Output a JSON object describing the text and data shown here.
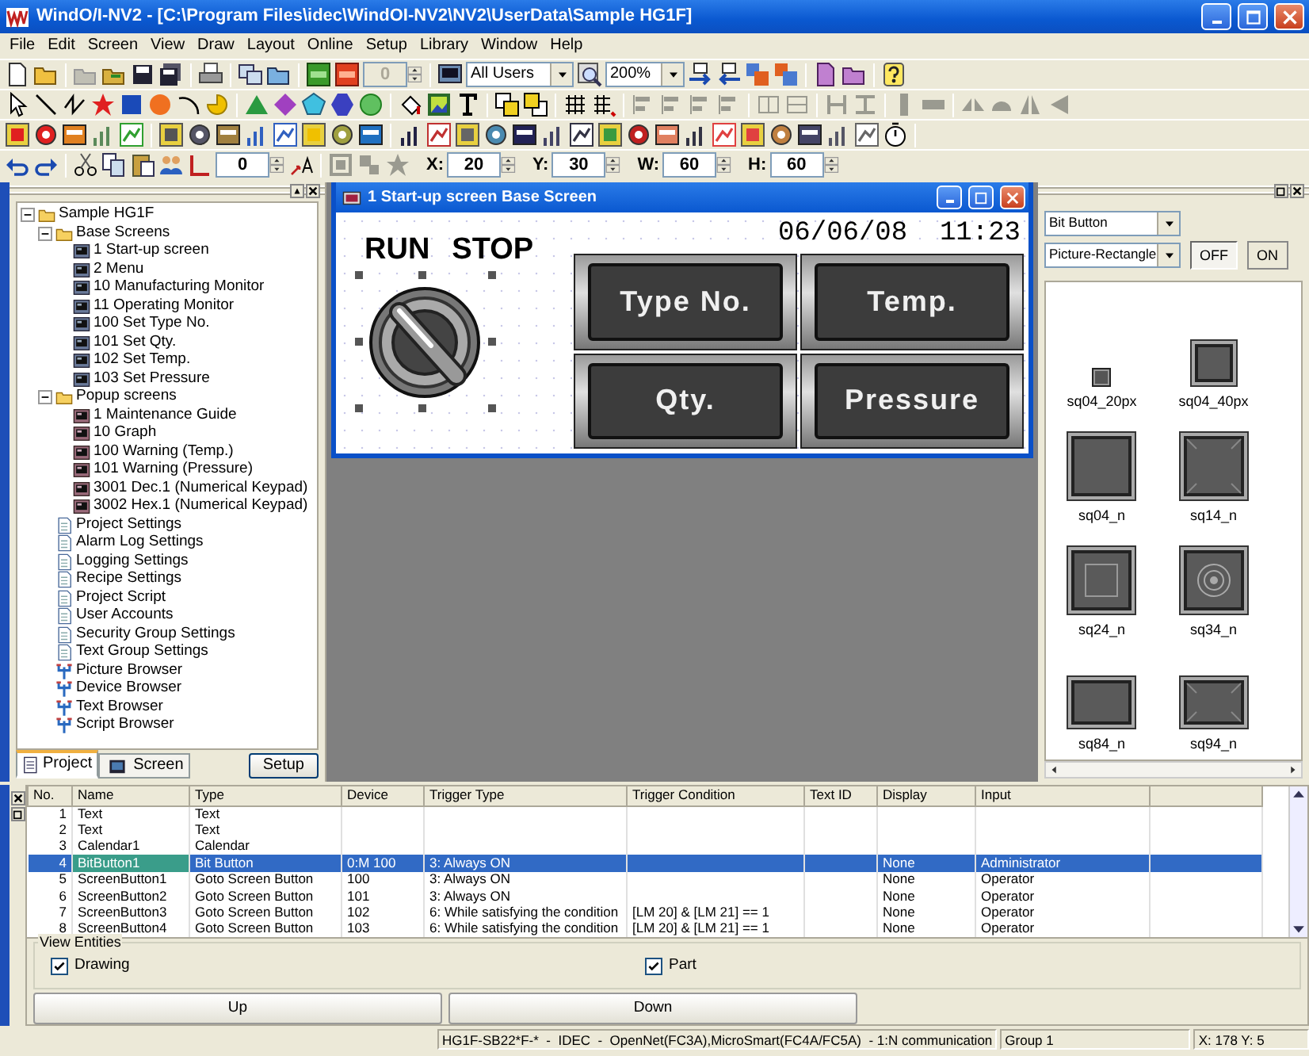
{
  "window": {
    "title": "WindO/I-NV2 - [C:\\Program Files\\idec\\WindOI-NV2\\NV2\\UserData\\Sample HG1F]"
  },
  "menu": [
    "File",
    "Edit",
    "Screen",
    "View",
    "Draw",
    "Layout",
    "Online",
    "Setup",
    "Library",
    "Window",
    "Help"
  ],
  "toolbar": {
    "spin_value": "0",
    "user_group": "All Users",
    "zoom": "200%"
  },
  "position_bar": {
    "rotate_value": "0",
    "fields": [
      {
        "label": "X:",
        "value": "20"
      },
      {
        "label": "Y:",
        "value": "30"
      },
      {
        "label": "W:",
        "value": "60"
      },
      {
        "label": "H:",
        "value": "60"
      }
    ]
  },
  "project_tree": {
    "label": "Sample HG1F",
    "kind": "folder",
    "expanded": true,
    "children": [
      {
        "label": "Base Screens",
        "kind": "folder",
        "expanded": true,
        "children": [
          {
            "label": "1 Start-up screen",
            "kind": "screen"
          },
          {
            "label": "2 Menu",
            "kind": "screen"
          },
          {
            "label": "10 Manufacturing Monitor",
            "kind": "screen"
          },
          {
            "label": "11 Operating Monitor",
            "kind": "screen"
          },
          {
            "label": "100 Set Type No.",
            "kind": "screen"
          },
          {
            "label": "101 Set Qty.",
            "kind": "screen"
          },
          {
            "label": "102 Set Temp.",
            "kind": "screen"
          },
          {
            "label": "103 Set Pressure",
            "kind": "screen"
          }
        ]
      },
      {
        "label": "Popup screens",
        "kind": "folder",
        "expanded": true,
        "children": [
          {
            "label": "1 Maintenance Guide",
            "kind": "popup"
          },
          {
            "label": "10 Graph",
            "kind": "popup"
          },
          {
            "label": "100 Warning (Temp.)",
            "kind": "popup"
          },
          {
            "label": "101 Warning (Pressure)",
            "kind": "popup"
          },
          {
            "label": "3001 Dec.1 (Numerical Keypad)",
            "kind": "popup"
          },
          {
            "label": "3002 Hex.1 (Numerical Keypad)",
            "kind": "popup"
          }
        ]
      },
      {
        "label": "Project Settings",
        "kind": "doc"
      },
      {
        "label": "Alarm Log Settings",
        "kind": "doc"
      },
      {
        "label": "Logging Settings",
        "kind": "doc"
      },
      {
        "label": "Recipe Settings",
        "kind": "doc"
      },
      {
        "label": "Project Script",
        "kind": "doc"
      },
      {
        "label": "User Accounts",
        "kind": "doc"
      },
      {
        "label": "Security Group Settings",
        "kind": "doc"
      },
      {
        "label": "Text Group Settings",
        "kind": "doc"
      },
      {
        "label": "Picture Browser",
        "kind": "browser"
      },
      {
        "label": "Device Browser",
        "kind": "browser"
      },
      {
        "label": "Text Browser",
        "kind": "browser"
      },
      {
        "label": "Script Browser",
        "kind": "browser"
      }
    ]
  },
  "project_tabs": [
    {
      "label": "Project",
      "selected": true
    },
    {
      "label": "Screen",
      "selected": false
    }
  ],
  "setup_button": "Setup",
  "screen_window": {
    "title": "1 Start-up screen Base Screen",
    "clock": "06/06/08  11:23",
    "switch_labels": [
      "RUN",
      "STOP"
    ],
    "buttons": [
      "Type No.",
      "Temp.",
      "Qty.",
      "Pressure"
    ]
  },
  "parts_panel": {
    "part_type": "Bit Button",
    "shape": "Picture-Rectangle",
    "states": [
      {
        "label": "OFF",
        "selected": true
      },
      {
        "label": "ON",
        "selected": false
      }
    ],
    "parts": [
      {
        "name": "sq04_20px",
        "kind": "small"
      },
      {
        "name": "sq04_40px",
        "kind": "medium"
      },
      {
        "name": "sq04_n",
        "kind": "plain"
      },
      {
        "name": "sq14_n",
        "kind": "bevel"
      },
      {
        "name": "sq24_n",
        "kind": "inset"
      },
      {
        "name": "sq34_n",
        "kind": "rings"
      },
      {
        "name": "sq84_n",
        "kind": "wide"
      },
      {
        "name": "sq94_n",
        "kind": "widebevel"
      }
    ]
  },
  "entity_table": {
    "columns": [
      "No.",
      "Name",
      "Type",
      "Device",
      "Trigger Type",
      "Trigger Condition",
      "Text ID",
      "Display",
      "Input"
    ],
    "rows": [
      {
        "cells": [
          "1",
          "Text",
          "Text",
          "",
          "",
          "",
          "",
          "",
          ""
        ],
        "selected": false
      },
      {
        "cells": [
          "2",
          "Text",
          "Text",
          "",
          "",
          "",
          "",
          "",
          ""
        ],
        "selected": false
      },
      {
        "cells": [
          "3",
          "Calendar1",
          "Calendar",
          "",
          "",
          "",
          "",
          "",
          ""
        ],
        "selected": false
      },
      {
        "cells": [
          "4",
          "BitButton1",
          "Bit Button",
          "0:M 100",
          "3: Always ON",
          "",
          "",
          "None",
          "Administrator"
        ],
        "selected": true
      },
      {
        "cells": [
          "5",
          "ScreenButton1",
          "Goto Screen Button",
          "100",
          "3: Always ON",
          "",
          "",
          "None",
          "Operator"
        ],
        "selected": false
      },
      {
        "cells": [
          "6",
          "ScreenButton2",
          "Goto Screen Button",
          "101",
          "3: Always ON",
          "",
          "",
          "None",
          "Operator"
        ],
        "selected": false
      },
      {
        "cells": [
          "7",
          "ScreenButton3",
          "Goto Screen Button",
          "102",
          "6: While satisfying the condition",
          "[LM 20] & [LM 21] == 1",
          "",
          "None",
          "Operator"
        ],
        "selected": false
      },
      {
        "cells": [
          "8",
          "ScreenButton4",
          "Goto Screen Button",
          "103",
          "6: While satisfying the condition",
          "[LM 20] & [LM 21] == 1",
          "",
          "None",
          "Operator"
        ],
        "selected": false
      }
    ]
  },
  "view_entities": {
    "title": "View Entities",
    "options": [
      {
        "label": "Drawing",
        "checked": true
      },
      {
        "label": "Part",
        "checked": true
      }
    ]
  },
  "nav_buttons": [
    "Up",
    "Down"
  ],
  "status_bar": [
    "HG1F-SB22*F-*  -  IDEC  -  OpenNet(FC3A),MicroSmart(FC4A/FC5A)  - 1:N communication",
    "Group 1",
    "X: 178 Y: 5"
  ]
}
